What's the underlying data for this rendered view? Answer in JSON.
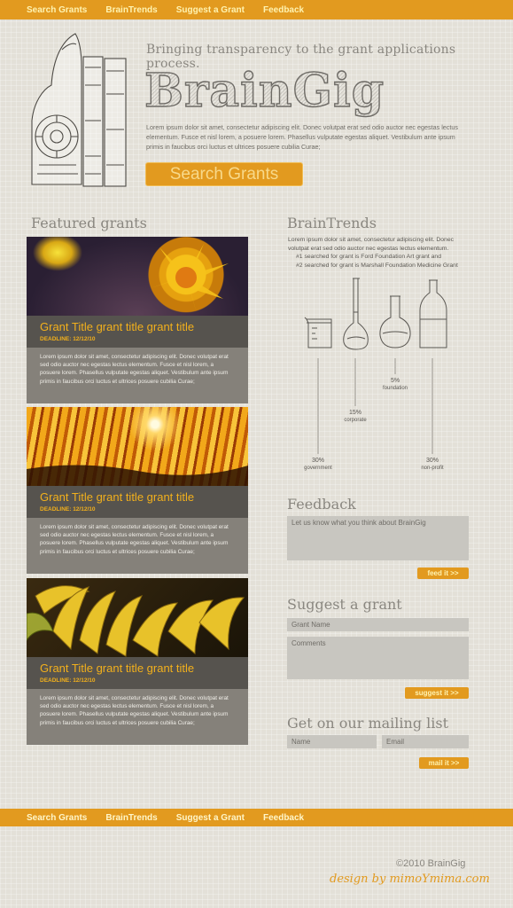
{
  "nav": [
    "Search Grants",
    "BrainTrends",
    "Suggest a Grant",
    "Feedback"
  ],
  "hero": {
    "tagline": "Bringing transparency to the grant applications process.",
    "brand": "BrainGig",
    "intro": "Lorem ipsum dolor sit amet, consectetur adipiscing elit. Donec volutpat erat sed odio auctor nec egestas lectus elementum. Fusce et nisl lorem, a posuere lorem. Phasellus vulputate egestas aliquet. Vestibulum ante ipsum primis in faucibus orci luctus et ultrices posuere cubilia Curae;",
    "cta": "Search Grants"
  },
  "featured": {
    "title": "Featured grants",
    "grants": [
      {
        "photo": "yellow-flower",
        "title": "Grant Title grant title grant title",
        "deadline": "DEADLINE: 12/12/10",
        "body": "Lorem ipsum dolor sit amet, consectetur adipiscing elit. Donec volutpat erat sed odio auctor nec egestas lectus elementum. Fusce et nisl lorem, a posuere lorem. Phasellus vulputate egestas aliquet. Vestibulum ante ipsum primis in faucibus orci luctus et ultrices posuere cubilia Curae;"
      },
      {
        "photo": "orange-petals",
        "title": "Grant Title grant title grant title",
        "deadline": "DEADLINE: 12/12/10",
        "body": "Lorem ipsum dolor sit amet, consectetur adipiscing elit. Donec volutpat erat sed odio auctor nec egestas lectus elementum. Fusce et nisl lorem, a posuere lorem. Phasellus vulputate egestas aliquet. Vestibulum ante ipsum primis in faucibus orci luctus et ultrices posuere cubilia Curae;"
      },
      {
        "photo": "bananas",
        "title": "Grant Title grant title grant title",
        "deadline": "DEADLINE: 12/12/10",
        "body": "Lorem ipsum dolor sit amet, consectetur adipiscing elit. Donec volutpat erat sed odio auctor nec egestas lectus elementum. Fusce et nisl lorem, a posuere lorem. Phasellus vulputate egestas aliquet. Vestibulum ante ipsum primis in faucibus orci luctus et ultrices posuere cubilia Curae;"
      }
    ]
  },
  "trends": {
    "title": "BrainTrends",
    "intro": "Lorem ipsum dolor sit amet, consectetur adipiscing elit. Donec volutpat erat sed odio auctor nec egestas lectus elementum.",
    "line1": "#1 searched for grant is Ford Foundation Art grant and",
    "line2": "#2 searched for grant is Marshall Foundation Medicine Grant",
    "items": [
      {
        "pct": "30%",
        "label": "government",
        "icon": "beaker-icon",
        "value": 30
      },
      {
        "pct": "15%",
        "label": "corporate",
        "icon": "volumetric-flask-icon",
        "value": 15
      },
      {
        "pct": "5%",
        "label": "foundation",
        "icon": "round-flask-icon",
        "value": 5
      },
      {
        "pct": "30%",
        "label": "non-profit",
        "icon": "bottle-icon",
        "value": 30
      }
    ]
  },
  "feedback": {
    "title": "Feedback",
    "placeholder": "Let us know what you think about BrainGig",
    "button": "feed it >>"
  },
  "suggest": {
    "title": "Suggest a grant",
    "name_placeholder": "Grant Name",
    "comments_placeholder": "Comments",
    "button": "suggest it >>"
  },
  "mailing": {
    "title": "Get on our mailing list",
    "name_placeholder": "Name",
    "email_placeholder": "Email",
    "button": "mail it >>"
  },
  "footer": {
    "copyright": "©2010 BrainGig",
    "credit": "design by mimoYmima.com"
  },
  "colors": {
    "accent": "#e29a1f",
    "background": "#e3e0d8",
    "card_body": "#85817a",
    "card_titlebar": "#56534e",
    "title_yellow": "#f2b01c"
  }
}
